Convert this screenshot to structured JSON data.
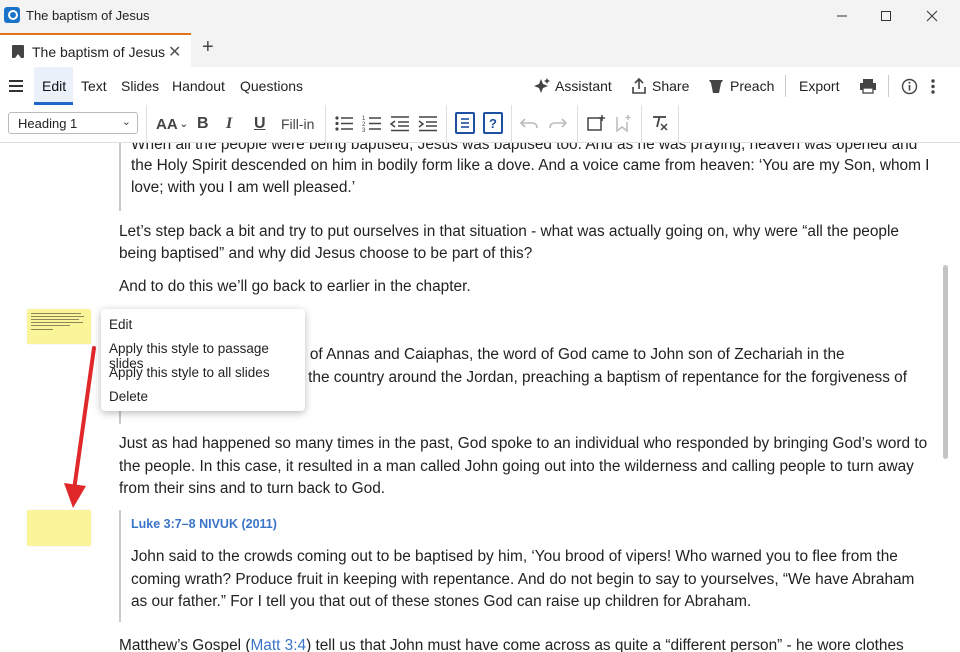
{
  "window": {
    "title": "The baptism of Jesus"
  },
  "tab": {
    "label": "The baptism of Jesus",
    "close": "✕",
    "new": "+"
  },
  "menu": {
    "tabs": [
      "Edit",
      "Text",
      "Slides",
      "Handout",
      "Questions"
    ],
    "assistant": "Assistant",
    "share": "Share",
    "preach": "Preach",
    "export": "Export"
  },
  "toolbar": {
    "style_value": "Heading 1",
    "fill_in": "Fill-in",
    "font_size": "AA",
    "bold": "B",
    "italic": "I",
    "underline": "U"
  },
  "document": {
    "quote1_lines": [
      "When all the people were being baptised, Jesus was baptised too. And as he was praying, heaven was opened and",
      "the Holy Spirit descended on him in bodily form like a dove. And a voice came from heaven: ‘You are my Son, whom I",
      "love; with you I am well pleased.’"
    ],
    "para1_lines": [
      "Let’s step back a bit and try to put ourselves in that situation - what was actually going on, why were “all the people",
      "being baptised” and why did Jesus choose to be part of this?"
    ],
    "para2": "And to do this we’ll go back to earlier in the chapter.",
    "quote2_line1": "d of Annas and Caiaphas, the word of God came to John son of Zechariah in the",
    "quote2_line2": "ll the country around the Jordan, preaching a baptism of repentance for the forgiveness of",
    "para3_lines": [
      "Just as had happened so many times in the past, God spoke to an individual who responded by bringing God’s word to",
      "the people. In this case, it resulted in a man called John going out into the wilderness and calling people to turn away",
      "from their sins and to turn back to God."
    ],
    "ref": "Luke 3:7–8 NIVUK (2011)",
    "quote3_lines": [
      "John said to the crowds coming out to be baptised by him, ‘You brood of vipers! Who warned you to flee from the",
      "coming wrath? Produce fruit in keeping with repentance. And do not begin to say to yourselves, “We have Abraham",
      "as our father.” For I tell you that out of these stones God can raise up children for Abraham."
    ],
    "para4_pre": "Matthew’s Gospel (",
    "para4_link": "Matt 3:4",
    "para4_post": ") tell us that John must have come across as quite a “different person” - he wore clothes"
  },
  "context_menu": {
    "items": [
      "Edit",
      "Apply this style to passage slides",
      "Apply this style to all slides",
      "Delete"
    ]
  },
  "colors": {
    "accent": "#1e66c8",
    "tab_accent": "#e3741c",
    "slide_thumb": "#fbf59a",
    "arrow": "#e0282a",
    "link": "#3a74c8"
  }
}
